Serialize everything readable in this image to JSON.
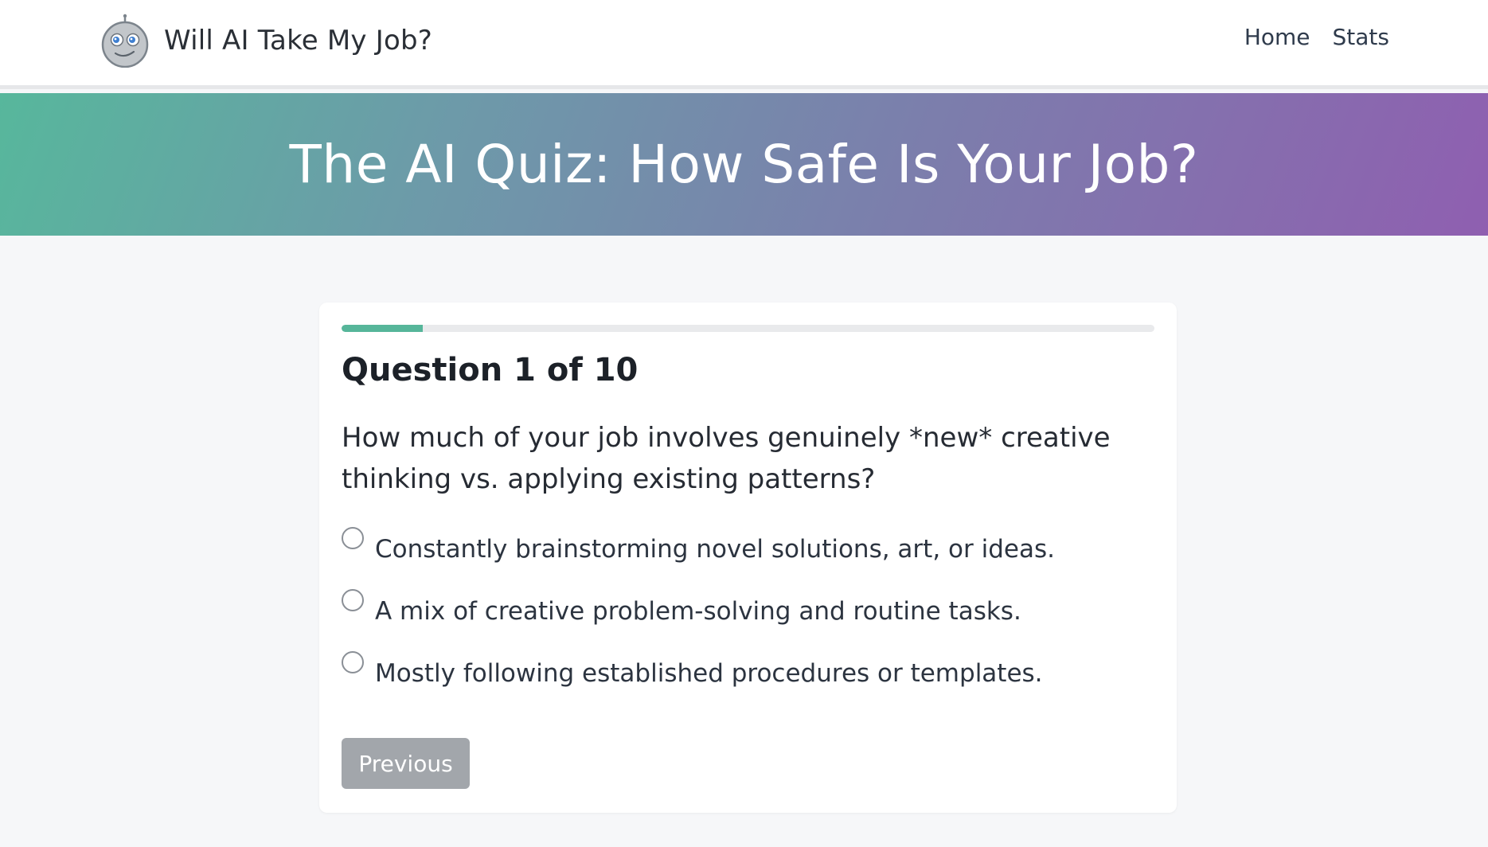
{
  "navbar": {
    "brand_text": "Will AI Take My Job?",
    "logo_icon": "robot-face-icon",
    "links": [
      "Home",
      "Stats"
    ]
  },
  "hero": {
    "title": "The AI Quiz: How Safe Is Your Job?",
    "gradient_colors": [
      "#57b79c",
      "#8f5fb0"
    ]
  },
  "quiz": {
    "progress_fraction": 0.1,
    "progress_color": "#56b69a",
    "counter": "Question 1 of 10",
    "question": "How much of your job involves genuinely *new* creative thinking vs. applying existing patterns?",
    "options": [
      "Constantly brainstorming novel solutions, art, or ideas.",
      "A mix of creative problem-solving and routine tasks.",
      "Mostly following established procedures or templates."
    ],
    "selected_option": null,
    "previous_label": "Previous"
  }
}
